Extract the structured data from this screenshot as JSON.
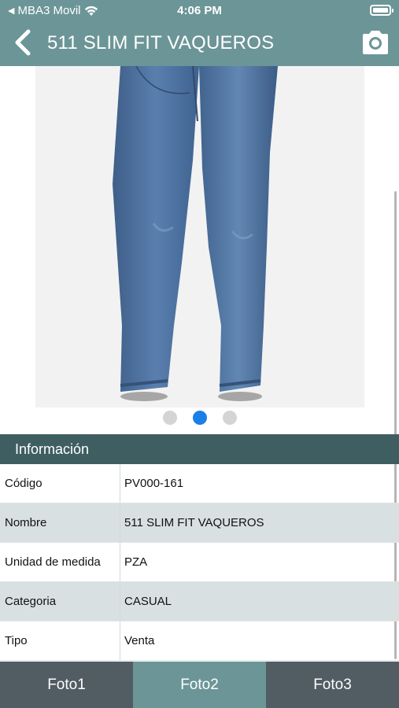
{
  "status": {
    "carrier": "MBA3 Movil",
    "time": "4:06 PM"
  },
  "nav": {
    "title": "511 SLIM FIT VAQUEROS"
  },
  "gallery": {
    "page_count": 3,
    "current_page": 2
  },
  "info": {
    "header": "Información",
    "rows": [
      {
        "label": "Código",
        "value": "PV000-161"
      },
      {
        "label": "Nombre",
        "value": "511 SLIM FIT VAQUEROS"
      },
      {
        "label": "Unidad de medida",
        "value": "PZA"
      },
      {
        "label": "Categoria",
        "value": "CASUAL"
      },
      {
        "label": "Tipo",
        "value": "Venta"
      }
    ]
  },
  "tabs": [
    {
      "label": "Foto1"
    },
    {
      "label": "Foto2"
    },
    {
      "label": "Foto3"
    }
  ],
  "colors": {
    "header_bg": "#6c9597",
    "info_header_bg": "#3f5e61",
    "tab_bar_bg": "#525c63",
    "active_dot": "#1a7fe6"
  }
}
